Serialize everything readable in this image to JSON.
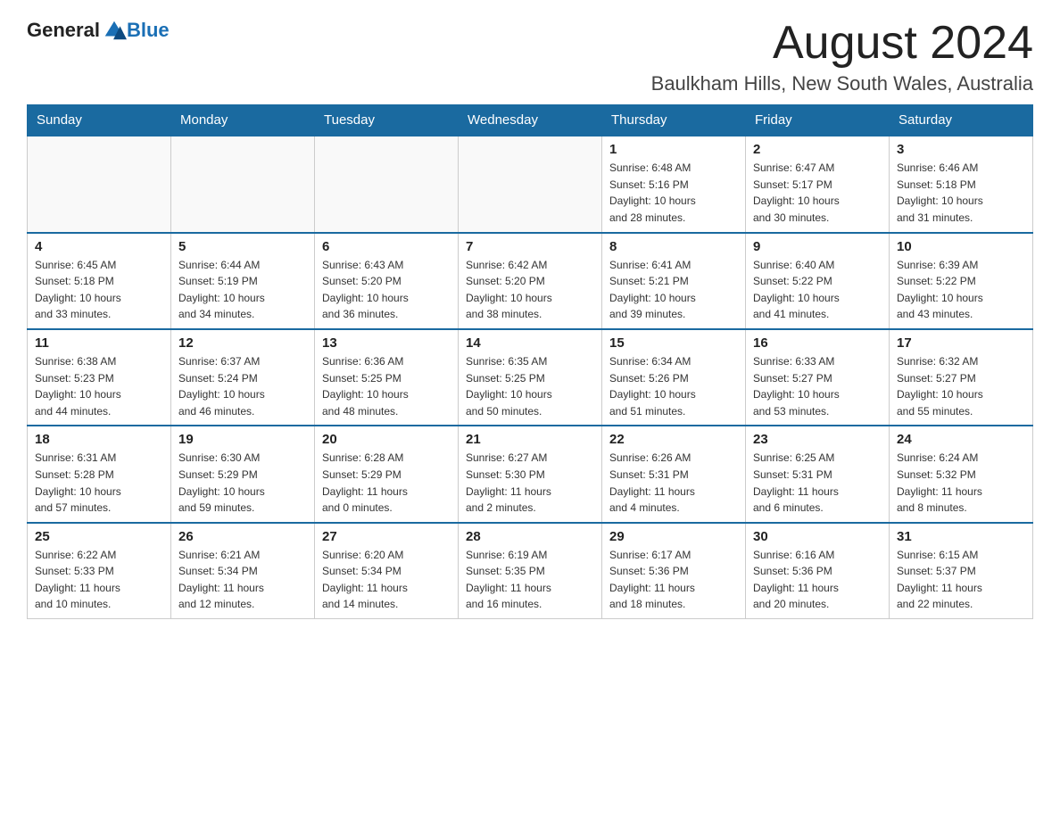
{
  "header": {
    "logo_general": "General",
    "logo_blue": "Blue",
    "month_title": "August 2024",
    "location": "Baulkham Hills, New South Wales, Australia"
  },
  "weekdays": [
    "Sunday",
    "Monday",
    "Tuesday",
    "Wednesday",
    "Thursday",
    "Friday",
    "Saturday"
  ],
  "weeks": [
    [
      {
        "day": "",
        "info": ""
      },
      {
        "day": "",
        "info": ""
      },
      {
        "day": "",
        "info": ""
      },
      {
        "day": "",
        "info": ""
      },
      {
        "day": "1",
        "info": "Sunrise: 6:48 AM\nSunset: 5:16 PM\nDaylight: 10 hours\nand 28 minutes."
      },
      {
        "day": "2",
        "info": "Sunrise: 6:47 AM\nSunset: 5:17 PM\nDaylight: 10 hours\nand 30 minutes."
      },
      {
        "day": "3",
        "info": "Sunrise: 6:46 AM\nSunset: 5:18 PM\nDaylight: 10 hours\nand 31 minutes."
      }
    ],
    [
      {
        "day": "4",
        "info": "Sunrise: 6:45 AM\nSunset: 5:18 PM\nDaylight: 10 hours\nand 33 minutes."
      },
      {
        "day": "5",
        "info": "Sunrise: 6:44 AM\nSunset: 5:19 PM\nDaylight: 10 hours\nand 34 minutes."
      },
      {
        "day": "6",
        "info": "Sunrise: 6:43 AM\nSunset: 5:20 PM\nDaylight: 10 hours\nand 36 minutes."
      },
      {
        "day": "7",
        "info": "Sunrise: 6:42 AM\nSunset: 5:20 PM\nDaylight: 10 hours\nand 38 minutes."
      },
      {
        "day": "8",
        "info": "Sunrise: 6:41 AM\nSunset: 5:21 PM\nDaylight: 10 hours\nand 39 minutes."
      },
      {
        "day": "9",
        "info": "Sunrise: 6:40 AM\nSunset: 5:22 PM\nDaylight: 10 hours\nand 41 minutes."
      },
      {
        "day": "10",
        "info": "Sunrise: 6:39 AM\nSunset: 5:22 PM\nDaylight: 10 hours\nand 43 minutes."
      }
    ],
    [
      {
        "day": "11",
        "info": "Sunrise: 6:38 AM\nSunset: 5:23 PM\nDaylight: 10 hours\nand 44 minutes."
      },
      {
        "day": "12",
        "info": "Sunrise: 6:37 AM\nSunset: 5:24 PM\nDaylight: 10 hours\nand 46 minutes."
      },
      {
        "day": "13",
        "info": "Sunrise: 6:36 AM\nSunset: 5:25 PM\nDaylight: 10 hours\nand 48 minutes."
      },
      {
        "day": "14",
        "info": "Sunrise: 6:35 AM\nSunset: 5:25 PM\nDaylight: 10 hours\nand 50 minutes."
      },
      {
        "day": "15",
        "info": "Sunrise: 6:34 AM\nSunset: 5:26 PM\nDaylight: 10 hours\nand 51 minutes."
      },
      {
        "day": "16",
        "info": "Sunrise: 6:33 AM\nSunset: 5:27 PM\nDaylight: 10 hours\nand 53 minutes."
      },
      {
        "day": "17",
        "info": "Sunrise: 6:32 AM\nSunset: 5:27 PM\nDaylight: 10 hours\nand 55 minutes."
      }
    ],
    [
      {
        "day": "18",
        "info": "Sunrise: 6:31 AM\nSunset: 5:28 PM\nDaylight: 10 hours\nand 57 minutes."
      },
      {
        "day": "19",
        "info": "Sunrise: 6:30 AM\nSunset: 5:29 PM\nDaylight: 10 hours\nand 59 minutes."
      },
      {
        "day": "20",
        "info": "Sunrise: 6:28 AM\nSunset: 5:29 PM\nDaylight: 11 hours\nand 0 minutes."
      },
      {
        "day": "21",
        "info": "Sunrise: 6:27 AM\nSunset: 5:30 PM\nDaylight: 11 hours\nand 2 minutes."
      },
      {
        "day": "22",
        "info": "Sunrise: 6:26 AM\nSunset: 5:31 PM\nDaylight: 11 hours\nand 4 minutes."
      },
      {
        "day": "23",
        "info": "Sunrise: 6:25 AM\nSunset: 5:31 PM\nDaylight: 11 hours\nand 6 minutes."
      },
      {
        "day": "24",
        "info": "Sunrise: 6:24 AM\nSunset: 5:32 PM\nDaylight: 11 hours\nand 8 minutes."
      }
    ],
    [
      {
        "day": "25",
        "info": "Sunrise: 6:22 AM\nSunset: 5:33 PM\nDaylight: 11 hours\nand 10 minutes."
      },
      {
        "day": "26",
        "info": "Sunrise: 6:21 AM\nSunset: 5:34 PM\nDaylight: 11 hours\nand 12 minutes."
      },
      {
        "day": "27",
        "info": "Sunrise: 6:20 AM\nSunset: 5:34 PM\nDaylight: 11 hours\nand 14 minutes."
      },
      {
        "day": "28",
        "info": "Sunrise: 6:19 AM\nSunset: 5:35 PM\nDaylight: 11 hours\nand 16 minutes."
      },
      {
        "day": "29",
        "info": "Sunrise: 6:17 AM\nSunset: 5:36 PM\nDaylight: 11 hours\nand 18 minutes."
      },
      {
        "day": "30",
        "info": "Sunrise: 6:16 AM\nSunset: 5:36 PM\nDaylight: 11 hours\nand 20 minutes."
      },
      {
        "day": "31",
        "info": "Sunrise: 6:15 AM\nSunset: 5:37 PM\nDaylight: 11 hours\nand 22 minutes."
      }
    ]
  ]
}
